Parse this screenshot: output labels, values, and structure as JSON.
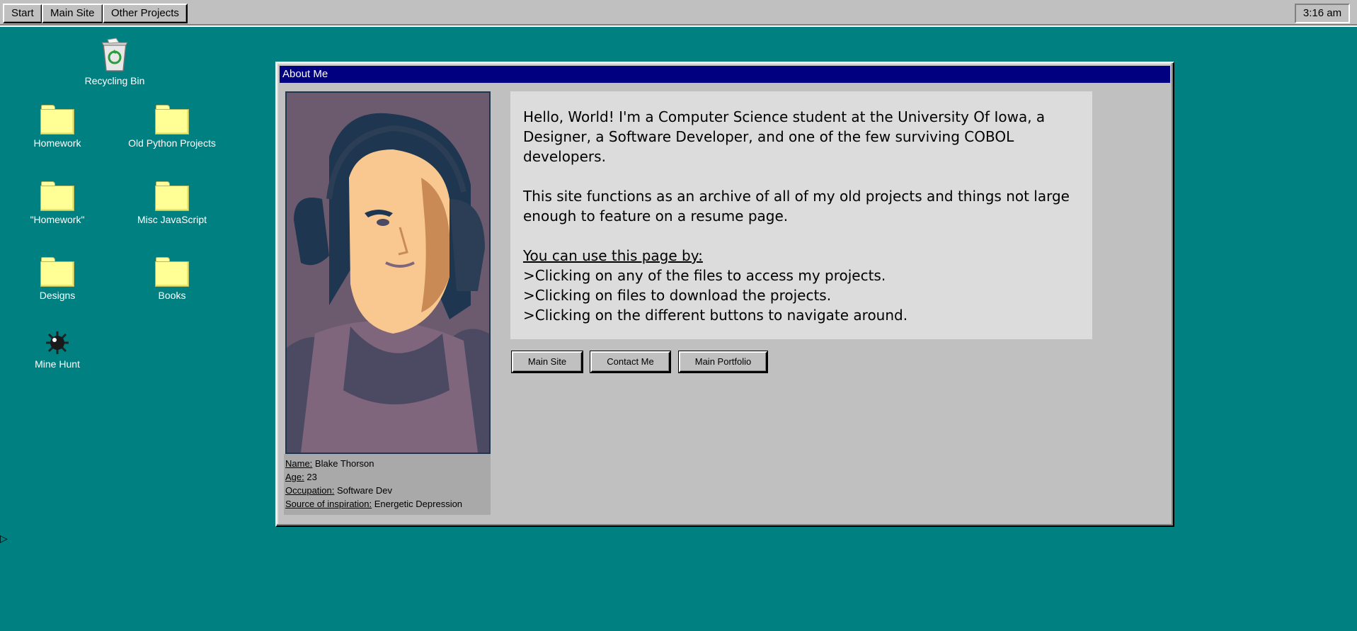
{
  "taskbar": {
    "start_label": "Start",
    "main_site_label": "Main Site",
    "other_projects_label": "Other Projects",
    "clock": "3:16 am"
  },
  "desktop": {
    "recycle_bin": "Recycling Bin",
    "folders": [
      "Homework",
      "Old Python Projects",
      "\"Homework\"",
      "Misc JavaScript",
      "Designs",
      "Books"
    ],
    "mine_hunt": "Mine Hunt"
  },
  "window": {
    "title": "About Me",
    "info": {
      "name_label": "Name:",
      "name_value": "Blake Thorson",
      "age_label": "Age:",
      "age_value": "23",
      "occupation_label": "Occupation:",
      "occupation_value": "Software Dev",
      "inspiration_label": "Source of inspiration:",
      "inspiration_value": "Energetic Depression"
    },
    "paragraph1": "Hello, World! I'm a Computer Science student at the University Of Iowa, a Designer, a Software Developer, and one of the few surviving COBOL developers.",
    "paragraph2": "This site functions as an archive of all of my old projects and things not large enough to feature on a resume page.",
    "howto_heading": "You can use this page by:",
    "howto_items": [
      ">Clicking on any of the files to access my projects.",
      ">Clicking on files to download the projects.",
      ">Clicking on the different buttons to navigate around."
    ],
    "buttons": {
      "main_site": "Main Site",
      "contact_me": "Contact Me",
      "main_portfolio": "Main Portfolio"
    }
  },
  "colors": {
    "desktop": "#008080",
    "titlebar": "#000080",
    "window": "#c0c0c0",
    "folder": "#ffff96"
  }
}
